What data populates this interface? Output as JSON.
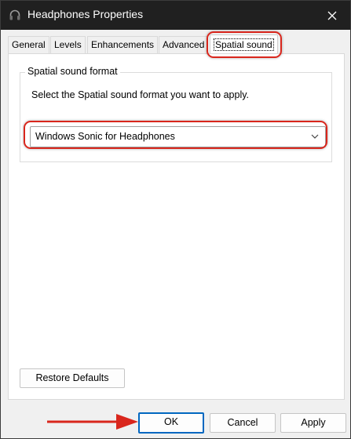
{
  "window": {
    "title": "Headphones Properties"
  },
  "tabs": [
    {
      "label": "General"
    },
    {
      "label": "Levels"
    },
    {
      "label": "Enhancements"
    },
    {
      "label": "Advanced"
    },
    {
      "label": "Spatial sound",
      "active": true
    }
  ],
  "spatial": {
    "group_title": "Spatial sound format",
    "description": "Select the Spatial sound format you want to apply.",
    "format_value": "Windows Sonic for Headphones"
  },
  "buttons": {
    "restore_defaults": "Restore Defaults",
    "ok": "OK",
    "cancel": "Cancel",
    "apply": "Apply"
  },
  "annotation_color": "#d9261c",
  "icons": {
    "app": "headphones-icon",
    "close": "close-icon",
    "dropdown": "chevron-down-icon",
    "annotation": "arrow-right-icon"
  }
}
